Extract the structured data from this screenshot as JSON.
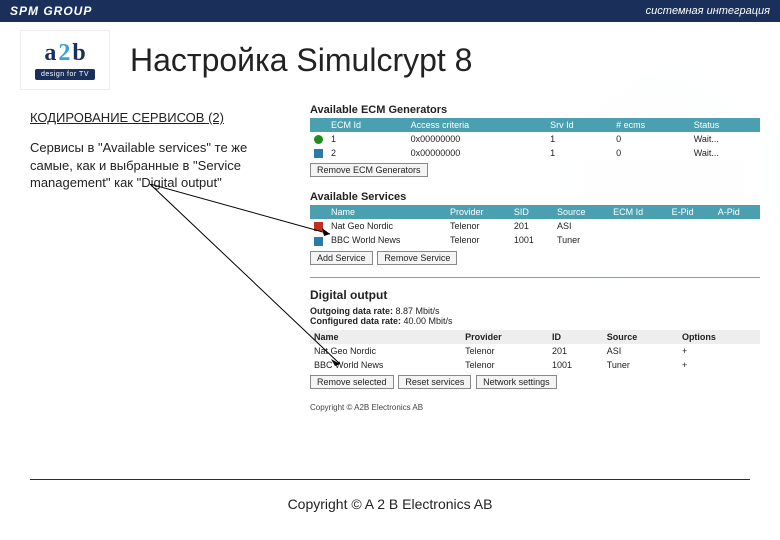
{
  "topbar": {
    "brand": "SPM GROUP",
    "tagline": "системная интеграция"
  },
  "logo": {
    "a": "a",
    "two": "2",
    "b": "b",
    "tag": "design for TV"
  },
  "title": "Настройка Simulcrypt 8",
  "left": {
    "subtitle": "КОДИРОВАНИЕ СЕРВИСОВ (2)",
    "body": "Сервисы в \"Available services\" те же самые, как и выбранные в \"Service management\" как \"Digital output\""
  },
  "ecm": {
    "title": "Available ECM Generators",
    "headers": [
      "",
      "ECM Id",
      "Access criteria",
      "Srv Id",
      "# ecms",
      "Status"
    ],
    "rows": [
      [
        "green",
        "1",
        "0x00000000",
        "1",
        "0",
        "Wait..."
      ],
      [
        "blue",
        "2",
        "0x00000000",
        "1",
        "0",
        "Wait..."
      ]
    ],
    "btn_remove": "Remove ECM Generators"
  },
  "serv": {
    "title": "Available Services",
    "headers": [
      "",
      "Name",
      "Provider",
      "SID",
      "Source",
      "ECM Id",
      "E-Pid",
      "A-Pid"
    ],
    "rows": [
      [
        "red",
        "Nat Geo Nordic",
        "Telenor",
        "201",
        "ASI",
        "",
        "",
        ""
      ],
      [
        "blue",
        "BBC World News",
        "Telenor",
        "1001",
        "Tuner",
        "",
        "",
        ""
      ]
    ],
    "btn_add": "Add Service",
    "btn_remove": "Remove Service"
  },
  "digital": {
    "title": "Digital output",
    "rate1_label": "Outgoing data rate:",
    "rate1_val": "8.87 Mbit/s",
    "rate2_label": "Configured data rate:",
    "rate2_val": "40.00 Mbit/s",
    "headers": [
      "Name",
      "Provider",
      "ID",
      "Source",
      "Options"
    ],
    "rows": [
      [
        "Nat Geo Nordic",
        "Telenor",
        "201",
        "ASI",
        "+"
      ],
      [
        "BBC World News",
        "Telenor",
        "1001",
        "Tuner",
        "+"
      ]
    ],
    "btn_remove": "Remove selected",
    "btn_reset": "Reset services",
    "btn_net": "Network settings"
  },
  "copyright_small": "Copyright © A2B Electronics AB",
  "copyright": "Copyright © A 2 B Electronics AB"
}
